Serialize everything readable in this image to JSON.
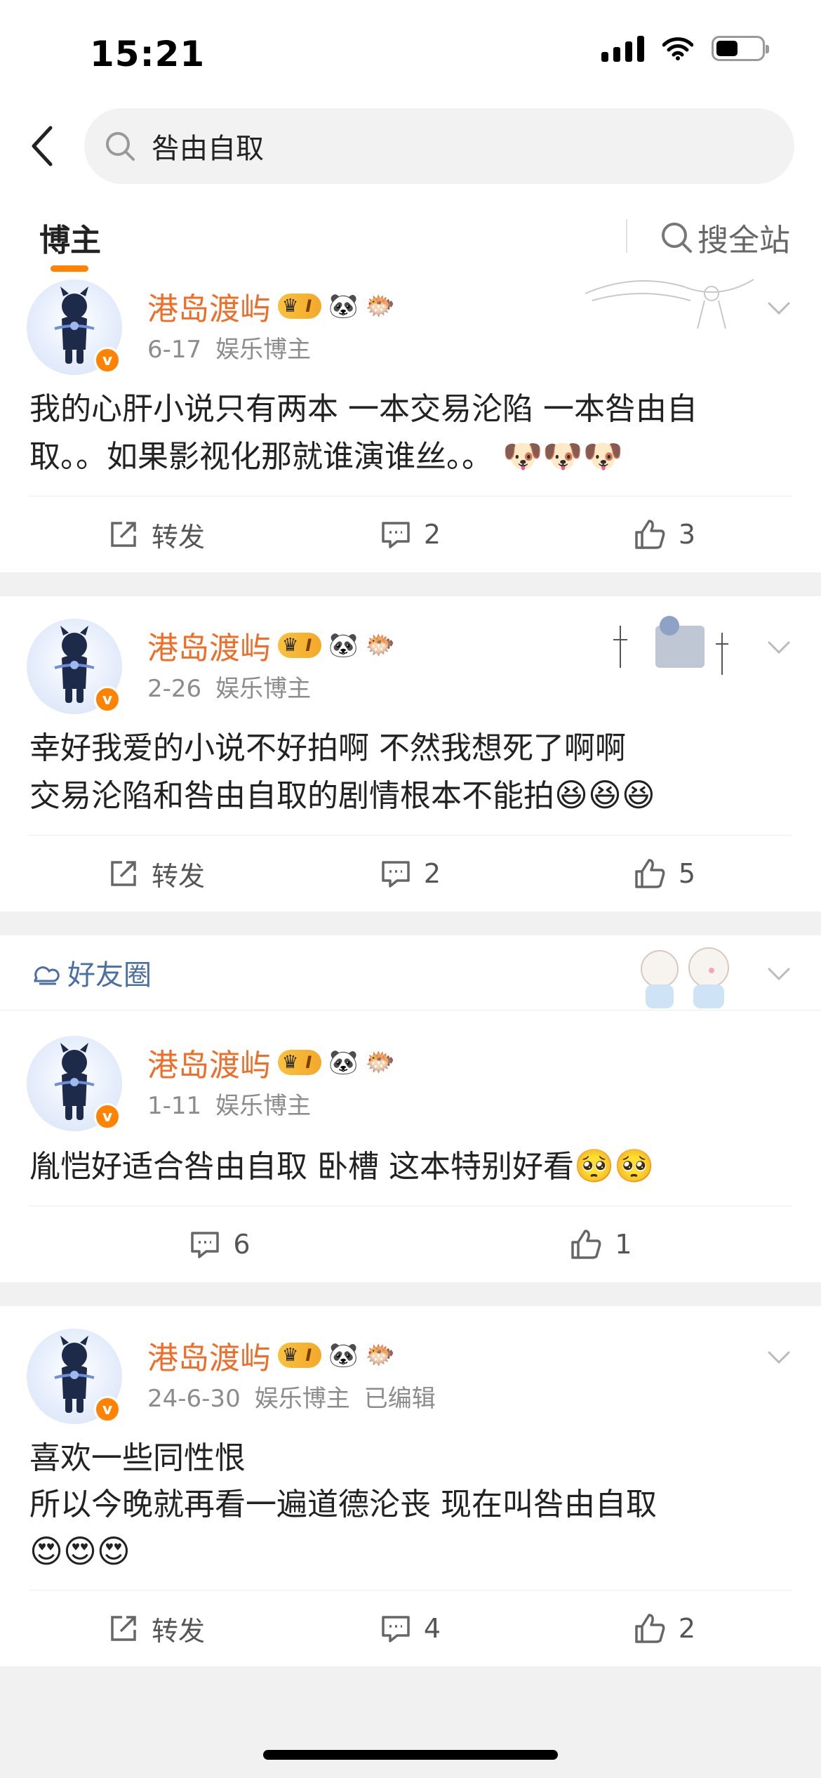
{
  "status_bar": {
    "time": "15:21"
  },
  "search": {
    "query": "咎由自取"
  },
  "tabs": {
    "active": "博主",
    "site_search": "搜全站"
  },
  "posts": [
    {
      "username": "港岛渡屿",
      "level": "I",
      "date": "6-17",
      "tag": "娱乐博主",
      "edited": "",
      "lines": [
        "我的心肝小说只有两本 一本交易沦陷 一本咎由自",
        "取。。如果影视化那就谁演谁丝。。"
      ],
      "emojis": "🐶🐶🐶",
      "repost": "转发",
      "comments": "2",
      "likes": "3"
    },
    {
      "username": "港岛渡屿",
      "level": "I",
      "date": "2-26",
      "tag": "娱乐博主",
      "edited": "",
      "lines": [
        "幸好我爱的小说不好拍啊 不然我想死了啊啊",
        "交易沦陷和咎由自取的剧情根本不能拍"
      ],
      "emojis": "😆😆😆",
      "repost": "转发",
      "comments": "2",
      "likes": "5"
    },
    {
      "circle_label": "好友圈",
      "username": "港岛渡屿",
      "level": "I",
      "date": "1-11",
      "tag": "娱乐博主",
      "edited": "",
      "lines": [
        "胤恺好适合咎由自取 卧槽 这本特别好看"
      ],
      "emojis": "🥺🥺",
      "comments": "6",
      "likes": "1"
    },
    {
      "username": "港岛渡屿",
      "level": "I",
      "date": "24-6-30",
      "tag": "娱乐博主",
      "edited": "已编辑",
      "lines": [
        "喜欢一些同性恨",
        "所以今晚就再看一遍道德沦丧 现在叫咎由自取"
      ],
      "emojis": "😍😍😍",
      "repost": "转发",
      "comments": "4",
      "likes": "2"
    }
  ],
  "badges": {
    "panda": "🐼",
    "fish": "🐡",
    "crown": "♛"
  }
}
